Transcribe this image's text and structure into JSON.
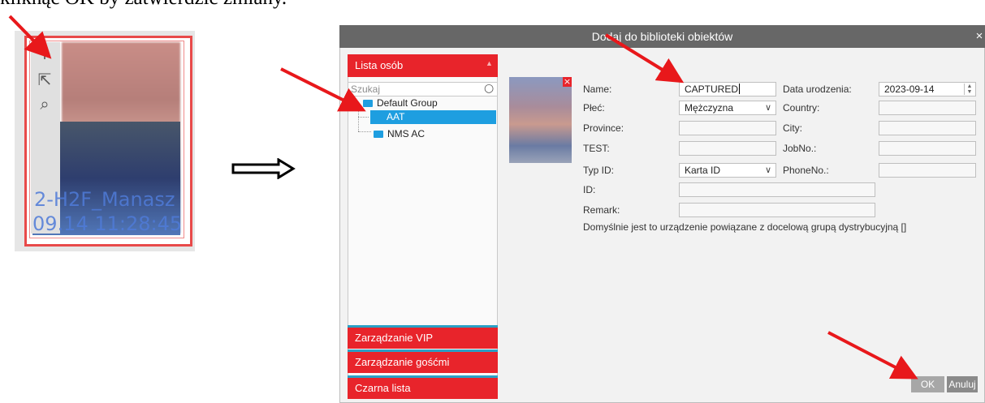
{
  "caption": "kliknąć OK by zatwierdzić zmiany.",
  "thumbnail": {
    "tools": [
      {
        "name": "plus-icon",
        "glyph": "+"
      },
      {
        "name": "export-icon",
        "glyph": "⇱"
      },
      {
        "name": "search-icon",
        "glyph": "⌕"
      }
    ],
    "overlay_line1": "2-H2F_Manasz",
    "overlay_line2": "09.14 11:28:45"
  },
  "dialog": {
    "title": "Dodaj do biblioteki obiektów",
    "close_glyph": "×",
    "sidebar": {
      "header": "Lista osób",
      "search_placeholder": "Szukaj",
      "tree": {
        "group": "Default Group",
        "items": [
          "AAT",
          "NMS AC"
        ],
        "selected": "AAT"
      },
      "buttons": [
        "Zarządzanie VIP",
        "Zarządzanie gośćmi",
        "Czarna lista"
      ]
    },
    "form": {
      "name_label": "Name:",
      "name_value": "CAPTURED",
      "dob_label": "Data urodzenia:",
      "dob_value": "2023-09-14",
      "gender_label": "Płeć:",
      "gender_value": "Mężczyzna",
      "country_label": "Country:",
      "country_value": "",
      "province_label": "Province:",
      "province_value": "",
      "city_label": "City:",
      "city_value": "",
      "test_label": "TEST:",
      "test_value": "",
      "jobno_label": "JobNo.:",
      "jobno_value": "",
      "idtype_label": "Typ ID:",
      "idtype_value": "Karta ID",
      "phone_label": "PhoneNo.:",
      "phone_value": "",
      "id_label": "ID:",
      "id_value": "",
      "remark_label": "Remark:",
      "remark_value": "",
      "note": "Domyślnie jest to urządzenie powiązane z docelową grupą dystrybucyjną []"
    },
    "ok_label": "OK",
    "cancel_label": "Anuluj"
  },
  "colors": {
    "accent_red": "#e8242b",
    "selection_blue": "#1e9ee0",
    "title_bar": "#676767",
    "annotation_arrow": "#e8181b"
  }
}
